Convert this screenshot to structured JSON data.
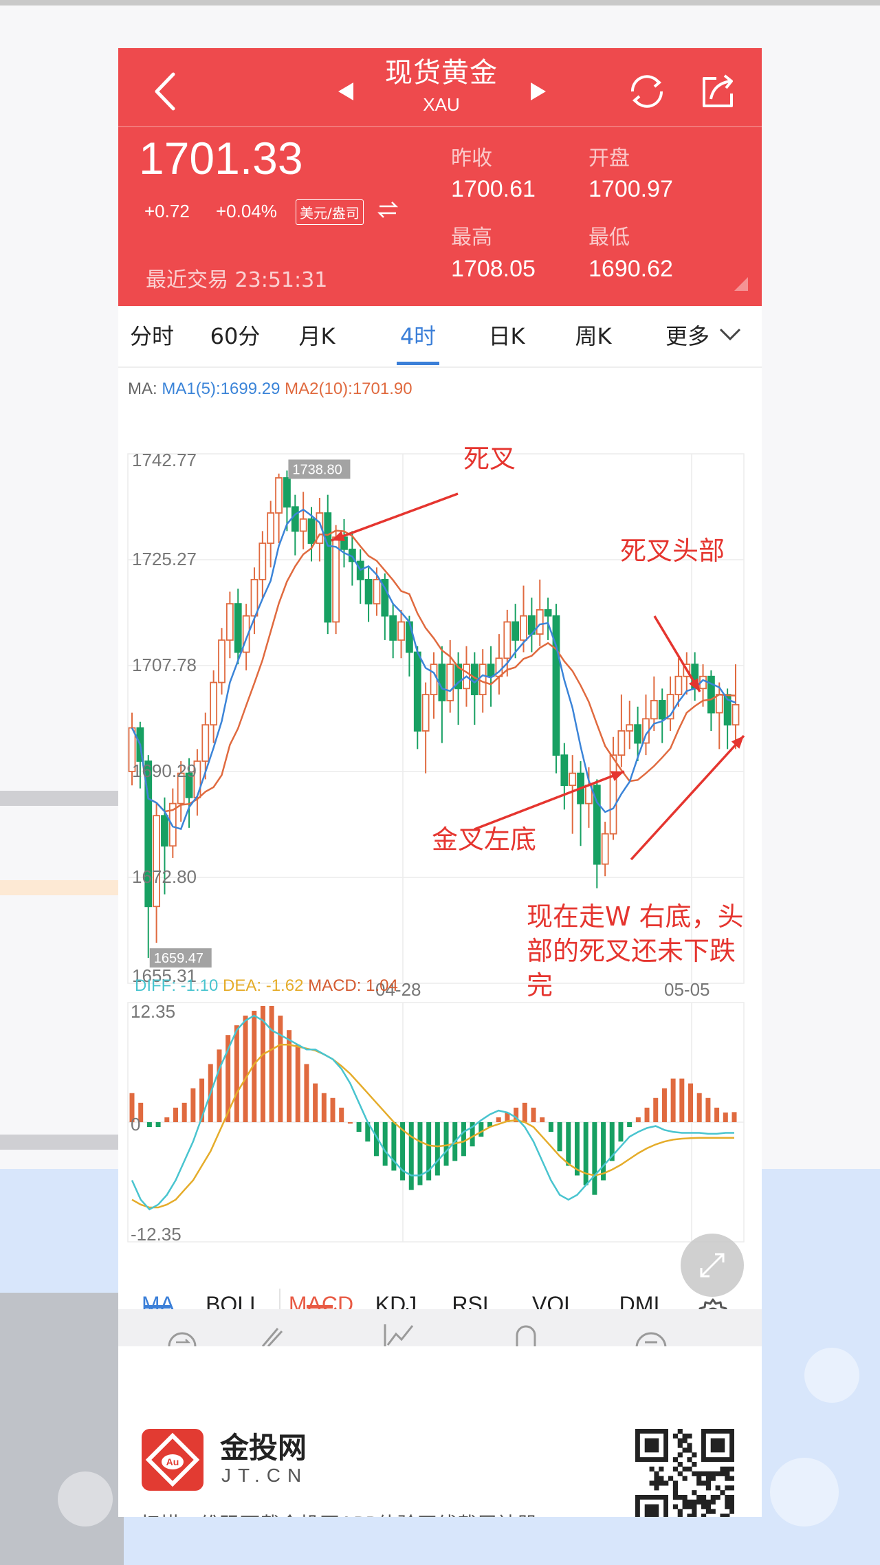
{
  "header": {
    "title": "现货黄金",
    "subtitle": "XAU",
    "price": "1701.33",
    "change": "+0.72",
    "change_pct": "+0.04%",
    "unit": "美元/盎司",
    "recent_trade_label": "最近交易",
    "recent_trade_time": "23:51:31",
    "prev_close_label": "昨收",
    "prev_close": "1700.61",
    "open_label": "开盘",
    "open": "1700.97",
    "high_label": "最高",
    "high": "1708.05",
    "low_label": "最低",
    "low": "1690.62"
  },
  "tabs": [
    {
      "label": "分时"
    },
    {
      "label": "60分"
    },
    {
      "label": "月K"
    },
    {
      "label": "4时",
      "active": true
    },
    {
      "label": "日K"
    },
    {
      "label": "周K"
    },
    {
      "label": "更多"
    }
  ],
  "ma_legend": {
    "prefix": "MA:",
    "ma1_label": "MA1(5):1699.29",
    "ma2_label": "MA2(10):1701.90"
  },
  "macd_legend": {
    "diff": "DIFF: -1.10",
    "dea": "DEA: -1.62",
    "macd": "MACD: 1.04"
  },
  "indicator_tabs": [
    "MA",
    "BOLL",
    "MACD",
    "KDJ",
    "RSI",
    "VOL",
    "DMI"
  ],
  "footer": {
    "brand": "金投网",
    "domain": "JT.CN",
    "scan_text": "扫描二维码下载金投网APP体验画线截屏神器"
  },
  "annotations": {
    "death_cross": "死叉",
    "death_cross_head": "死叉头部",
    "golden_cross_left": "金叉左底",
    "w_line1": "现在走W 右底，头",
    "w_line2": "部的死叉还未下跌",
    "w_line3": "完"
  },
  "colors": {
    "header_red": "#ee4a4d",
    "up_candle": "#e06a3f",
    "down_candle": "#17a062",
    "ma1": "#3b84d8",
    "ma2": "#e06a3f",
    "annotation": "#e5352f"
  },
  "chart_data": [
    {
      "type": "candlestick",
      "title": "",
      "yticks": [
        "1742.77",
        "1725.27",
        "1707.78",
        "1690.29",
        "1672.80",
        "1655.31"
      ],
      "ylim": [
        1655.31,
        1742.77
      ],
      "xticks": [
        "04-28",
        "05-05"
      ],
      "max_label": "1738.80",
      "min_label": "1659.47",
      "candles": [
        [
          1690.3,
          1697.5,
          1700.0,
          1688.0
        ],
        [
          1697.5,
          1692.0,
          1698.5,
          1687.5
        ],
        [
          1692.0,
          1668.0,
          1693.0,
          1659.5
        ],
        [
          1668.0,
          1683.0,
          1685.0,
          1662.0
        ],
        [
          1683.0,
          1678.0,
          1686.0,
          1670.0
        ],
        [
          1678.0,
          1685.0,
          1687.5,
          1676.0
        ],
        [
          1685.0,
          1690.0,
          1692.0,
          1682.0
        ],
        [
          1690.0,
          1686.0,
          1692.5,
          1681.0
        ],
        [
          1686.0,
          1692.0,
          1694.0,
          1683.0
        ],
        [
          1692.0,
          1698.0,
          1700.0,
          1689.0
        ],
        [
          1698.0,
          1705.0,
          1707.0,
          1695.0
        ],
        [
          1705.0,
          1712.0,
          1714.0,
          1703.0
        ],
        [
          1712.0,
          1718.0,
          1720.0,
          1709.0
        ],
        [
          1718.0,
          1710.0,
          1720.5,
          1708.0
        ],
        [
          1710.0,
          1716.0,
          1718.0,
          1707.0
        ],
        [
          1716.0,
          1722.0,
          1724.0,
          1713.0
        ],
        [
          1722.0,
          1728.0,
          1730.0,
          1719.0
        ],
        [
          1728.0,
          1733.0,
          1735.0,
          1724.0
        ],
        [
          1733.0,
          1738.8,
          1739.5,
          1728.0
        ],
        [
          1738.8,
          1734.0,
          1740.0,
          1730.0
        ],
        [
          1734.0,
          1730.0,
          1736.0,
          1726.0
        ],
        [
          1730.0,
          1732.0,
          1736.5,
          1727.0
        ],
        [
          1732.0,
          1728.0,
          1734.0,
          1725.0
        ],
        [
          1728.0,
          1733.0,
          1735.5,
          1725.0
        ],
        [
          1733.0,
          1715.0,
          1736.0,
          1713.0
        ],
        [
          1715.0,
          1729.0,
          1731.0,
          1713.0
        ],
        [
          1729.0,
          1727.0,
          1732.0,
          1724.0
        ],
        [
          1727.0,
          1725.0,
          1730.0,
          1721.0
        ],
        [
          1725.0,
          1722.0,
          1727.0,
          1718.0
        ],
        [
          1722.0,
          1718.0,
          1724.0,
          1715.0
        ],
        [
          1718.0,
          1722.0,
          1724.0,
          1716.0
        ],
        [
          1722.0,
          1716.0,
          1723.0,
          1712.0
        ],
        [
          1716.0,
          1712.0,
          1718.0,
          1709.0
        ],
        [
          1712.0,
          1715.0,
          1717.0,
          1709.0
        ],
        [
          1715.0,
          1710.0,
          1716.0,
          1706.0
        ],
        [
          1710.0,
          1697.0,
          1711.0,
          1694.0
        ],
        [
          1697.0,
          1703.0,
          1705.0,
          1690.0
        ],
        [
          1703.0,
          1708.0,
          1710.0,
          1699.0
        ],
        [
          1708.0,
          1702.0,
          1711.0,
          1695.0
        ],
        [
          1702.0,
          1708.0,
          1712.0,
          1700.0
        ],
        [
          1708.0,
          1704.0,
          1710.0,
          1698.0
        ],
        [
          1704.0,
          1708.0,
          1711.0,
          1701.0
        ],
        [
          1708.0,
          1703.0,
          1710.0,
          1698.0
        ],
        [
          1703.0,
          1708.0,
          1710.5,
          1700.0
        ],
        [
          1708.0,
          1706.0,
          1711.0,
          1701.0
        ],
        [
          1706.0,
          1709.0,
          1713.0,
          1703.0
        ],
        [
          1709.0,
          1715.0,
          1717.0,
          1706.0
        ],
        [
          1715.0,
          1712.0,
          1718.0,
          1709.0
        ],
        [
          1712.0,
          1716.0,
          1721.0,
          1710.0
        ],
        [
          1716.0,
          1713.0,
          1719.0,
          1710.0
        ],
        [
          1713.0,
          1717.0,
          1722.0,
          1711.0
        ],
        [
          1717.0,
          1716.0,
          1719.0,
          1712.0
        ],
        [
          1716.0,
          1693.0,
          1718.0,
          1690.0
        ],
        [
          1693.0,
          1688.0,
          1695.0,
          1684.0
        ],
        [
          1688.0,
          1690.0,
          1693.0,
          1680.0
        ],
        [
          1690.0,
          1685.0,
          1692.0,
          1678.0
        ],
        [
          1685.0,
          1688.0,
          1691.0,
          1681.0
        ],
        [
          1688.0,
          1675.0,
          1689.0,
          1671.0
        ],
        [
          1675.0,
          1680.0,
          1682.0,
          1673.0
        ],
        [
          1680.0,
          1693.0,
          1696.0,
          1679.0
        ],
        [
          1693.0,
          1697.0,
          1703.0,
          1691.0
        ],
        [
          1697.0,
          1698.0,
          1702.0,
          1694.0
        ],
        [
          1698.0,
          1695.0,
          1701.0,
          1692.0
        ],
        [
          1695.0,
          1699.0,
          1703.0,
          1693.0
        ],
        [
          1699.0,
          1702.0,
          1706.0,
          1697.0
        ],
        [
          1702.0,
          1699.0,
          1704.0,
          1695.0
        ],
        [
          1699.0,
          1703.0,
          1706.0,
          1697.0
        ],
        [
          1703.0,
          1706.0,
          1709.0,
          1701.0
        ],
        [
          1706.0,
          1708.0,
          1710.0,
          1703.0
        ],
        [
          1708.0,
          1704.0,
          1710.0,
          1702.0
        ],
        [
          1704.0,
          1706.0,
          1708.0,
          1701.0
        ],
        [
          1706.0,
          1700.0,
          1707.0,
          1697.0
        ],
        [
          1700.0,
          1703.0,
          1705.0,
          1694.0
        ],
        [
          1703.0,
          1698.0,
          1704.0,
          1694.0
        ],
        [
          1698.0,
          1701.33,
          1708.0,
          1694.0
        ]
      ]
    },
    {
      "type": "macd",
      "yticks": [
        "12.35",
        "0",
        "-12.35"
      ],
      "ylim": [
        -12.35,
        12.35
      ],
      "hist": [
        3,
        2,
        -0.5,
        -0.5,
        0.5,
        1.5,
        2,
        3.5,
        4.5,
        6,
        7.5,
        9,
        10,
        11,
        11.5,
        12,
        12,
        11,
        9.5,
        8,
        6,
        4,
        3,
        2.5,
        1.5,
        0,
        -1,
        -2,
        -3.5,
        -4.5,
        -5,
        -6,
        -7,
        -6.5,
        -6,
        -5.5,
        -4.5,
        -4,
        -3.5,
        -2.5,
        -1.5,
        -0.5,
        0.5,
        1,
        1.5,
        2,
        1.5,
        0.5,
        -1,
        -3,
        -4.5,
        -5.5,
        -6.5,
        -7.5,
        -6,
        -4,
        -2,
        -0.5,
        0.5,
        1.5,
        2.5,
        3.5,
        4.5,
        4.5,
        4,
        3,
        2.5,
        1.5,
        1,
        1.04
      ],
      "diff": [
        -6,
        -8,
        -9,
        -8.5,
        -7.5,
        -6,
        -4,
        -2,
        0.5,
        3,
        5.5,
        7.5,
        9.5,
        10.5,
        11,
        10.5,
        9.5,
        9,
        8.5,
        8,
        7.5,
        7.5,
        7,
        6.5,
        5.5,
        4,
        2,
        0,
        -1.5,
        -3,
        -4,
        -5,
        -5.5,
        -5.5,
        -5,
        -4,
        -3,
        -2,
        -1,
        -0.5,
        0.2,
        0.8,
        1.2,
        1,
        0.5,
        -0.5,
        -2,
        -4,
        -6,
        -7.5,
        -8,
        -7.5,
        -6.5,
        -5.5,
        -4.5,
        -3.5,
        -2.5,
        -1.5,
        -1,
        -0.6,
        -0.4,
        -0.8,
        -1,
        -1.1,
        -1.1,
        -1.1,
        -1.2,
        -1.2,
        -1.1,
        -1.1
      ],
      "dea": [
        -8,
        -8.5,
        -8.8,
        -8.8,
        -8.5,
        -8,
        -7,
        -6,
        -4.5,
        -3,
        -1,
        1,
        3,
        4.5,
        6,
        7,
        7.5,
        8,
        8,
        7.8,
        7.6,
        7.4,
        7,
        6.5,
        5.8,
        5,
        4,
        3,
        2,
        1,
        0,
        -0.8,
        -1.5,
        -2,
        -2.4,
        -2.5,
        -2.4,
        -2.2,
        -2,
        -1.5,
        -1,
        -0.5,
        -0.2,
        0.1,
        0.2,
        0,
        -0.5,
        -1.5,
        -2.5,
        -3.5,
        -4.3,
        -4.9,
        -5.3,
        -5.5,
        -5.3,
        -4.9,
        -4.4,
        -3.8,
        -3.2,
        -2.7,
        -2.3,
        -2,
        -1.8,
        -1.7,
        -1.65,
        -1.62,
        -1.62,
        -1.62,
        -1.62,
        -1.62
      ]
    }
  ]
}
